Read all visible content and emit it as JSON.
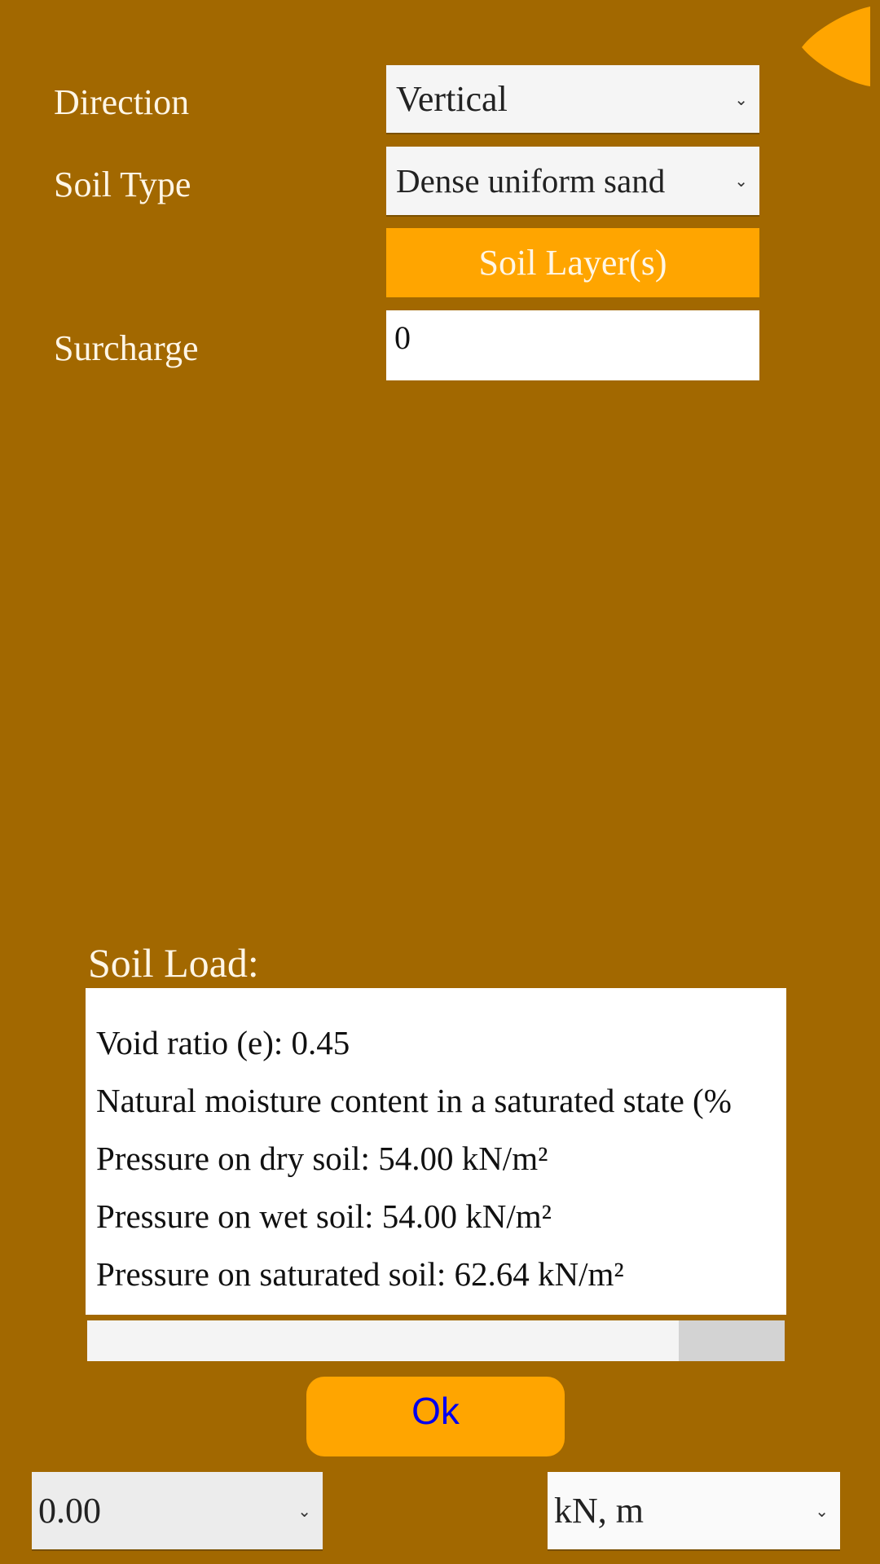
{
  "corner_button": {
    "icon": "back-triangle-icon",
    "color": "#ffa500"
  },
  "form": {
    "direction_label": "Direction",
    "direction_value": "Vertical",
    "soil_type_label": "Soil Type",
    "soil_type_value": "Dense uniform sand",
    "soil_layers_button": "Soil Layer(s)",
    "surcharge_label": "Surcharge",
    "surcharge_value": "0"
  },
  "result": {
    "title": "Soil Load:",
    "lines": [
      "Void ratio (e): 0.45",
      "Natural moisture content in a saturated state (%",
      "Pressure on dry soil: 54.00 kN/m²",
      "Pressure on wet soil: 54.00 kN/m²",
      "Pressure on saturated soil: 62.64 kN/m²"
    ]
  },
  "ok_button": "Ok",
  "footer": {
    "precision_value": "0.00",
    "units_value": "kN, m"
  },
  "colors": {
    "background": "#a26800",
    "accent": "#ffa500",
    "ok_text": "#0000ee"
  }
}
